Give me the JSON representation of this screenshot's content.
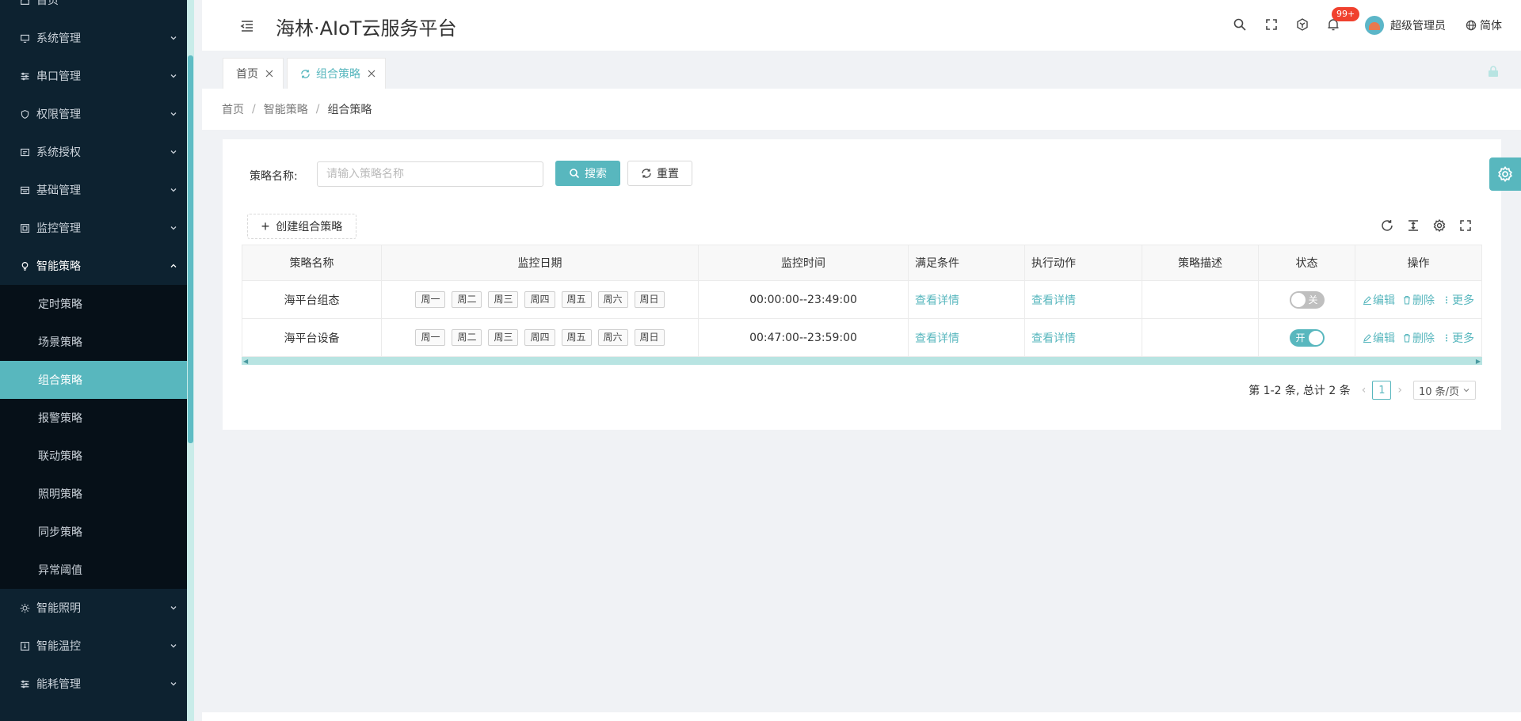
{
  "app": {
    "title": "海林·AIoT云服务平台"
  },
  "header": {
    "notification_badge": "99+",
    "username": "超级管理员",
    "language": "简体"
  },
  "sidebar": {
    "items": [
      {
        "label": "首页",
        "icon": "home-icon",
        "expandable": false
      },
      {
        "label": "系统管理",
        "icon": "monitor-icon",
        "expandable": true
      },
      {
        "label": "串口管理",
        "icon": "sliders-icon",
        "expandable": true
      },
      {
        "label": "权限管理",
        "icon": "shield-icon",
        "expandable": true
      },
      {
        "label": "系统授权",
        "icon": "license-icon",
        "expandable": true
      },
      {
        "label": "基础管理",
        "icon": "database-icon",
        "expandable": true
      },
      {
        "label": "监控管理",
        "icon": "monitor-box-icon",
        "expandable": true
      },
      {
        "label": "智能策略",
        "icon": "bulb-icon",
        "expandable": true,
        "open": true
      },
      {
        "label": "智能照明",
        "icon": "sun-icon",
        "expandable": true
      },
      {
        "label": "智能温控",
        "icon": "thermo-icon",
        "expandable": true
      },
      {
        "label": "能耗管理",
        "icon": "sliders-icon",
        "expandable": true
      }
    ],
    "strategy_submenu": [
      "定时策略",
      "场景策略",
      "组合策略",
      "报警策略",
      "联动策略",
      "照明策略",
      "同步策略",
      "异常阈值"
    ],
    "active_submenu": "组合策略"
  },
  "tabs": [
    {
      "label": "首页",
      "active": false
    },
    {
      "label": "组合策略",
      "active": true
    }
  ],
  "breadcrumb": [
    "首页",
    "智能策略",
    "组合策略"
  ],
  "search": {
    "label": "策略名称:",
    "placeholder": "请输入策略名称",
    "search_button": "搜索",
    "reset_button": "重置"
  },
  "toolbar": {
    "create_button": "创建组合策略"
  },
  "table": {
    "columns": [
      "策略名称",
      "监控日期",
      "监控时间",
      "满足条件",
      "执行动作",
      "策略描述",
      "状态",
      "操作"
    ],
    "rows": [
      {
        "name": "海平台组态",
        "days": [
          "周一",
          "周二",
          "周三",
          "周四",
          "周五",
          "周六",
          "周日"
        ],
        "time": "00:00:00--23:49:00",
        "condition": "查看详情",
        "action": "查看详情",
        "desc": "",
        "status_on": false,
        "status_label": "关"
      },
      {
        "name": "海平台设备",
        "days": [
          "周一",
          "周二",
          "周三",
          "周四",
          "周五",
          "周六",
          "周日"
        ],
        "time": "00:47:00--23:59:00",
        "condition": "查看详情",
        "action": "查看详情",
        "desc": "",
        "status_on": true,
        "status_label": "开"
      }
    ],
    "ops": {
      "edit": "编辑",
      "delete": "删除",
      "more": "更多"
    }
  },
  "pagination": {
    "summary": "第 1-2 条, 总计 2 条",
    "current_page": "1",
    "page_size": "10 条/页"
  },
  "colors": {
    "accent": "#58b7be",
    "sidebar_bg": "#0d2230",
    "badge": "#f0412e"
  }
}
